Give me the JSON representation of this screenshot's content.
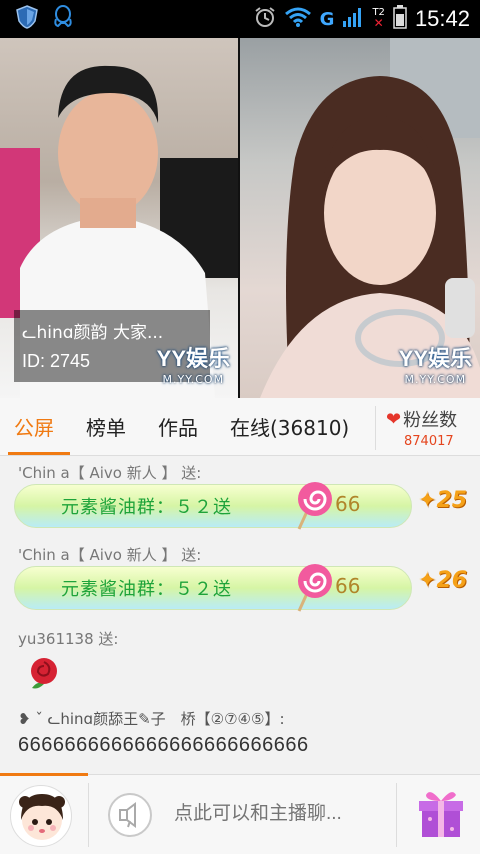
{
  "status_bar": {
    "time": "15:42",
    "network": "G",
    "sim2": "T2",
    "icons": [
      "shield-icon",
      "qq-icon",
      "alarm-icon",
      "wifi-icon",
      "signal-icon",
      "battery-icon"
    ]
  },
  "videos": {
    "left_host_name": "ᓚhinɑ颜韵 大家...",
    "left_host_id": "ID: 2745",
    "watermark_top": "YY娱乐",
    "watermark_bottom": "M.YY.COM"
  },
  "tabs": {
    "items": [
      "公屏",
      "榜单",
      "作品",
      "在线(36810)"
    ],
    "active_index": 0,
    "fans_label": "粉丝数",
    "fans_count": "874017"
  },
  "chat": {
    "messages": [
      {
        "sender": "'Chin a【 Aivo 新人 】 送:",
        "gift_text": "元素酱油群：５２送",
        "gift_count": "66",
        "combo": "25"
      },
      {
        "sender": "'Chin a【 Aivo 新人 】 送:",
        "gift_text": "元素酱油群：５２送",
        "gift_count": "66",
        "combo": "26"
      }
    ],
    "rose_sender": "yu361138 送:",
    "last_meta": "❥ ˇ ᓚhinɑ颜舔王✎子　桥【②⑦④⑤】:",
    "last_text": "6666666666666666666666666"
  },
  "input_bar": {
    "placeholder": "点此可以和主播聊..."
  },
  "colors": {
    "accent": "#f07a12",
    "fans_count": "#e5451e",
    "gift_text": "#1ea33a",
    "combo": "#f5a118"
  }
}
